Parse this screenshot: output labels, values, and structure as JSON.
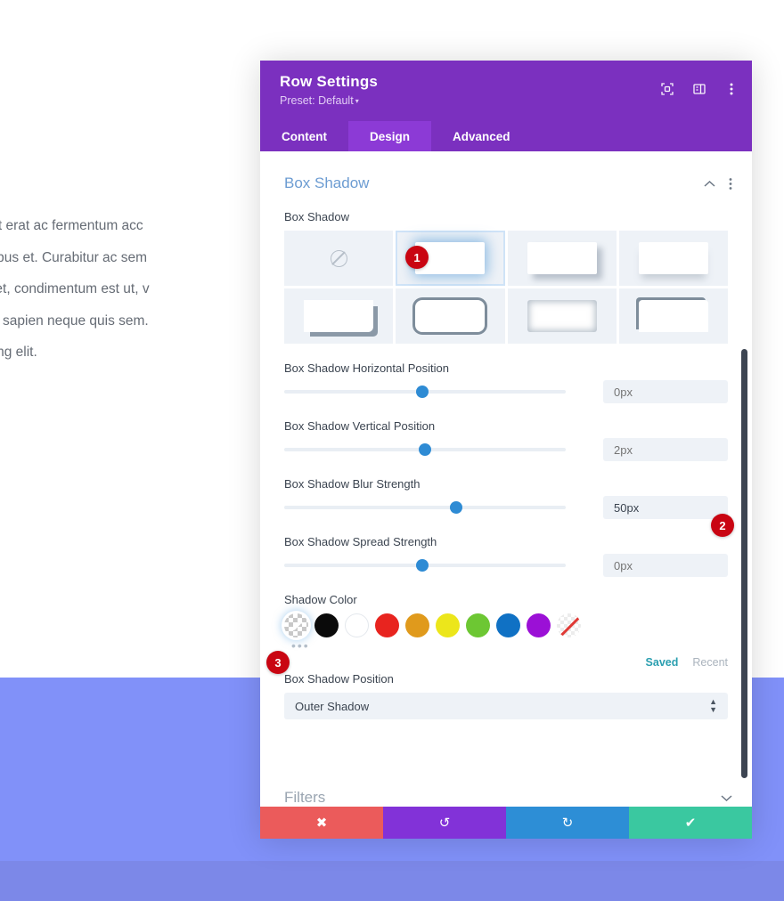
{
  "background": {
    "text_lines": [
      "pien. Donec placerat erat ac fermentum acc",
      "eu congue odio tempus et. Curabitur ac sem",
      "m vitae augue aliquet, condimentum est ut, v",
      "r enim, nec faucibus sapien neque quis sem. ",
      "consectetur adipiscing elit."
    ],
    "band_color": "#8191f9",
    "footer_color": "#7c88e8"
  },
  "modal": {
    "title": "Row Settings",
    "preset_label": "Preset: Default",
    "preset_caret": "▾",
    "header_icons": [
      {
        "name": "focus-target-icon"
      },
      {
        "name": "panel-layout-icon"
      },
      {
        "name": "more-vertical-icon"
      }
    ],
    "tabs": [
      {
        "label": "Content",
        "active": false
      },
      {
        "label": "Design",
        "active": true
      },
      {
        "label": "Advanced",
        "active": false
      }
    ],
    "accent_color": "#7b30bf",
    "tab_active_color": "#8c3ad6"
  },
  "section": {
    "title": "Box Shadow",
    "collapse_icon": "chevron-up",
    "menu_icon": "more-vertical"
  },
  "box_shadow": {
    "label": "Box Shadow",
    "presets": [
      {
        "id": "none",
        "style": "none",
        "selected": false
      },
      {
        "id": "glow",
        "style": "r1",
        "selected": true
      },
      {
        "id": "offset-soft",
        "style": "r2",
        "selected": false
      },
      {
        "id": "drop-below",
        "style": "r3",
        "selected": false
      },
      {
        "id": "hard-corner",
        "style": "r4",
        "selected": false
      },
      {
        "id": "outline",
        "style": "r5",
        "selected": false
      },
      {
        "id": "inner",
        "style": "r6",
        "selected": false
      },
      {
        "id": "top-left",
        "style": "r7",
        "selected": false
      }
    ]
  },
  "sliders": [
    {
      "name": "horizontal-position",
      "label": "Box Shadow Horizontal Position",
      "value": "0px",
      "is_placeholder": true,
      "thumb_pct": 49
    },
    {
      "name": "vertical-position",
      "label": "Box Shadow Vertical Position",
      "value": "2px",
      "is_placeholder": true,
      "thumb_pct": 50
    },
    {
      "name": "blur-strength",
      "label": "Box Shadow Blur Strength",
      "value": "50px",
      "is_placeholder": false,
      "thumb_pct": 61
    },
    {
      "name": "spread-strength",
      "label": "Box Shadow Spread Strength",
      "value": "0px",
      "is_placeholder": true,
      "thumb_pct": 49
    }
  ],
  "shadow_color": {
    "label": "Shadow Color",
    "swatches": [
      {
        "name": "transparent-picker",
        "hex": "transparent",
        "type": "checker",
        "selected": true
      },
      {
        "name": "black",
        "hex": "#0a0a0a",
        "type": "solid",
        "selected": false
      },
      {
        "name": "white",
        "hex": "#ffffff",
        "type": "white",
        "selected": false
      },
      {
        "name": "red",
        "hex": "#e8241f",
        "type": "solid",
        "selected": false
      },
      {
        "name": "orange",
        "hex": "#e09a1c",
        "type": "solid",
        "selected": false
      },
      {
        "name": "yellow",
        "hex": "#ece61b",
        "type": "solid",
        "selected": false
      },
      {
        "name": "green",
        "hex": "#6dc733",
        "type": "solid",
        "selected": false
      },
      {
        "name": "blue",
        "hex": "#1071c4",
        "type": "solid",
        "selected": false
      },
      {
        "name": "purple",
        "hex": "#9b10d6",
        "type": "solid",
        "selected": false
      },
      {
        "name": "none",
        "hex": "none",
        "type": "none",
        "selected": false
      }
    ],
    "more_dots": "•••",
    "tabs": [
      {
        "label": "Saved",
        "active": true
      },
      {
        "label": "Recent",
        "active": false
      }
    ]
  },
  "shadow_position": {
    "label": "Box Shadow Position",
    "value": "Outer Shadow"
  },
  "filters": {
    "title": "Filters",
    "expand_icon": "chevron-down"
  },
  "actions": [
    {
      "name": "cancel-button",
      "icon": "✖",
      "color": "#eb5b5b"
    },
    {
      "name": "undo-button",
      "icon": "↺",
      "color": "#8232d8"
    },
    {
      "name": "redo-button",
      "icon": "↻",
      "color": "#2d8ed6"
    },
    {
      "name": "save-button",
      "icon": "✔",
      "color": "#3ac8a0"
    }
  ],
  "badges": [
    {
      "id": "1",
      "label": "1"
    },
    {
      "id": "2",
      "label": "2"
    },
    {
      "id": "3",
      "label": "3"
    }
  ]
}
